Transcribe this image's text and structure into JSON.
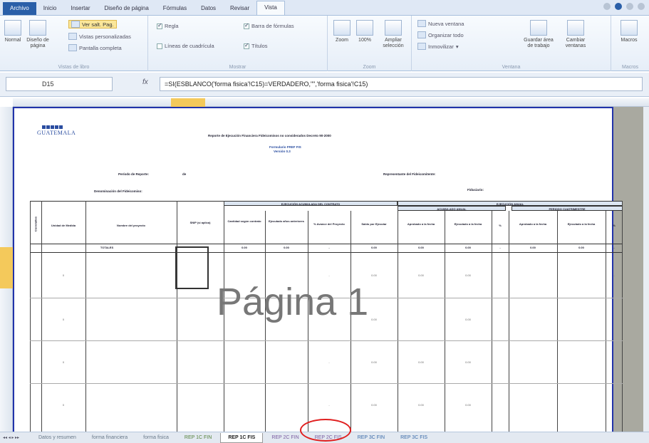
{
  "ribbon_tabs": [
    "Archivo",
    "Inicio",
    "Insertar",
    "Diseño de página",
    "Fórmulas",
    "Datos",
    "Revisar",
    "Vista"
  ],
  "active_tab": "Vista",
  "ribbon": {
    "views": {
      "normal": "Normal",
      "page_layout": "Diseño de página",
      "page_break": "Ver salt. Pag.",
      "custom_views": "Vistas personalizadas",
      "full_screen": "Pantalla completa",
      "label": "Vistas de libro"
    },
    "show": {
      "ruler": "Regla",
      "gridlines": "Líneas de cuadrícula",
      "formula_bar": "Barra de fórmulas",
      "headings": "Títulos",
      "label": "Mostrar"
    },
    "zoom": {
      "zoom": "Zoom",
      "hundred": "100%",
      "selection": "Ampliar selección",
      "label": "Zoom"
    },
    "window": {
      "new_window": "Nueva ventana",
      "arrange_all": "Organizar todo",
      "freeze": "Inmovilizar",
      "save_workspace": "Guardar área de trabajo",
      "switch_windows": "Cambiar ventanas",
      "label": "Ventana"
    },
    "macros": {
      "macros": "Macros",
      "label": "Macros"
    }
  },
  "formula_bar": {
    "name_box": "D15",
    "fx": "fx",
    "formula": "=SI(ESBLANCO('forma fisica'!C15)=VERDADERO,\"\",'forma fisica'!C15)"
  },
  "report": {
    "logo_text": "GUATEMALA",
    "title": "Reporte de Ejecución Financiera Fideicomisos no considerados Decreto 90-2000",
    "form": "Formulario FREF FIS",
    "version": "Versión 0.3",
    "period_label": "Período de Reporte:",
    "period_value": "de",
    "trust_label": "Denominación del Fideicomiso:",
    "representative_label": "Representante del Fideicomitente:",
    "trustee_label": "Fiduciario:",
    "band_contract": "EJECUCIÓN ACUMULADA DEL CONTRATO",
    "band_annual": "EJECUCIÓN ANUAL",
    "band_accum_annual": "ACUMULADO ANUAL",
    "band_period": "PERIODO CUATRIMESTRE",
    "col_headers": [
      "Correlativo",
      "Unidad de Medida",
      "Nombre del proyecto",
      "SNIP (si aplica)",
      "Cantidad según contrato",
      "Ejecutado años anteriores",
      "% Avance del Proyecto",
      "Saldo por Ejecutar",
      "Aprobado a la fecha",
      "Ejecutado a la fecha",
      "%",
      "Aprobado a la fecha",
      "Ejecutado a la fecha",
      "%"
    ],
    "totals_label": "TOTALES",
    "totals": [
      "0.00",
      "0.00",
      "-",
      "0.00",
      "0.00",
      "0.00",
      "-",
      "0.00",
      "0.00",
      "-"
    ],
    "row_values": [
      "0",
      "-",
      "0.00",
      "0.00",
      "0.00",
      "-"
    ],
    "watermark": "Página 1"
  },
  "sheet_tabs": [
    "Datos y resumen",
    "forma financiera",
    "forma fisica",
    "REP 1C FIN",
    "REP 1C FIS",
    "REP 2C FIN",
    "REP 2C FIS",
    "REP 3C FIN",
    "REP 3C FIS"
  ],
  "active_sheet": "REP 1C FIS"
}
